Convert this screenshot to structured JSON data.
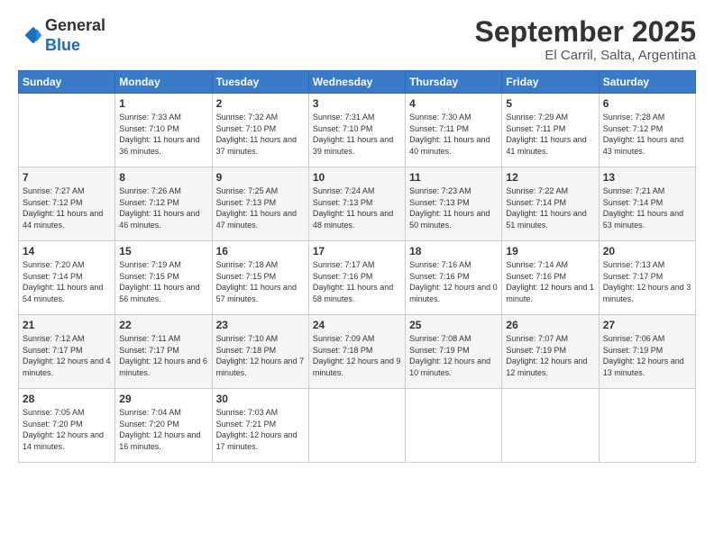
{
  "header": {
    "logo": {
      "line1": "General",
      "line2": "Blue"
    },
    "title": "September 2025",
    "subtitle": "El Carril, Salta, Argentina"
  },
  "weekdays": [
    "Sunday",
    "Monday",
    "Tuesday",
    "Wednesday",
    "Thursday",
    "Friday",
    "Saturday"
  ],
  "weeks": [
    [
      {
        "day": "",
        "sunrise": "",
        "sunset": "",
        "daylight": ""
      },
      {
        "day": "1",
        "sunrise": "Sunrise: 7:33 AM",
        "sunset": "Sunset: 7:10 PM",
        "daylight": "Daylight: 11 hours and 36 minutes."
      },
      {
        "day": "2",
        "sunrise": "Sunrise: 7:32 AM",
        "sunset": "Sunset: 7:10 PM",
        "daylight": "Daylight: 11 hours and 37 minutes."
      },
      {
        "day": "3",
        "sunrise": "Sunrise: 7:31 AM",
        "sunset": "Sunset: 7:10 PM",
        "daylight": "Daylight: 11 hours and 39 minutes."
      },
      {
        "day": "4",
        "sunrise": "Sunrise: 7:30 AM",
        "sunset": "Sunset: 7:11 PM",
        "daylight": "Daylight: 11 hours and 40 minutes."
      },
      {
        "day": "5",
        "sunrise": "Sunrise: 7:29 AM",
        "sunset": "Sunset: 7:11 PM",
        "daylight": "Daylight: 11 hours and 41 minutes."
      },
      {
        "day": "6",
        "sunrise": "Sunrise: 7:28 AM",
        "sunset": "Sunset: 7:12 PM",
        "daylight": "Daylight: 11 hours and 43 minutes."
      }
    ],
    [
      {
        "day": "7",
        "sunrise": "Sunrise: 7:27 AM",
        "sunset": "Sunset: 7:12 PM",
        "daylight": "Daylight: 11 hours and 44 minutes."
      },
      {
        "day": "8",
        "sunrise": "Sunrise: 7:26 AM",
        "sunset": "Sunset: 7:12 PM",
        "daylight": "Daylight: 11 hours and 46 minutes."
      },
      {
        "day": "9",
        "sunrise": "Sunrise: 7:25 AM",
        "sunset": "Sunset: 7:13 PM",
        "daylight": "Daylight: 11 hours and 47 minutes."
      },
      {
        "day": "10",
        "sunrise": "Sunrise: 7:24 AM",
        "sunset": "Sunset: 7:13 PM",
        "daylight": "Daylight: 11 hours and 48 minutes."
      },
      {
        "day": "11",
        "sunrise": "Sunrise: 7:23 AM",
        "sunset": "Sunset: 7:13 PM",
        "daylight": "Daylight: 11 hours and 50 minutes."
      },
      {
        "day": "12",
        "sunrise": "Sunrise: 7:22 AM",
        "sunset": "Sunset: 7:14 PM",
        "daylight": "Daylight: 11 hours and 51 minutes."
      },
      {
        "day": "13",
        "sunrise": "Sunrise: 7:21 AM",
        "sunset": "Sunset: 7:14 PM",
        "daylight": "Daylight: 11 hours and 53 minutes."
      }
    ],
    [
      {
        "day": "14",
        "sunrise": "Sunrise: 7:20 AM",
        "sunset": "Sunset: 7:14 PM",
        "daylight": "Daylight: 11 hours and 54 minutes."
      },
      {
        "day": "15",
        "sunrise": "Sunrise: 7:19 AM",
        "sunset": "Sunset: 7:15 PM",
        "daylight": "Daylight: 11 hours and 56 minutes."
      },
      {
        "day": "16",
        "sunrise": "Sunrise: 7:18 AM",
        "sunset": "Sunset: 7:15 PM",
        "daylight": "Daylight: 11 hours and 57 minutes."
      },
      {
        "day": "17",
        "sunrise": "Sunrise: 7:17 AM",
        "sunset": "Sunset: 7:16 PM",
        "daylight": "Daylight: 11 hours and 58 minutes."
      },
      {
        "day": "18",
        "sunrise": "Sunrise: 7:16 AM",
        "sunset": "Sunset: 7:16 PM",
        "daylight": "Daylight: 12 hours and 0 minutes."
      },
      {
        "day": "19",
        "sunrise": "Sunrise: 7:14 AM",
        "sunset": "Sunset: 7:16 PM",
        "daylight": "Daylight: 12 hours and 1 minute."
      },
      {
        "day": "20",
        "sunrise": "Sunrise: 7:13 AM",
        "sunset": "Sunset: 7:17 PM",
        "daylight": "Daylight: 12 hours and 3 minutes."
      }
    ],
    [
      {
        "day": "21",
        "sunrise": "Sunrise: 7:12 AM",
        "sunset": "Sunset: 7:17 PM",
        "daylight": "Daylight: 12 hours and 4 minutes."
      },
      {
        "day": "22",
        "sunrise": "Sunrise: 7:11 AM",
        "sunset": "Sunset: 7:17 PM",
        "daylight": "Daylight: 12 hours and 6 minutes."
      },
      {
        "day": "23",
        "sunrise": "Sunrise: 7:10 AM",
        "sunset": "Sunset: 7:18 PM",
        "daylight": "Daylight: 12 hours and 7 minutes."
      },
      {
        "day": "24",
        "sunrise": "Sunrise: 7:09 AM",
        "sunset": "Sunset: 7:18 PM",
        "daylight": "Daylight: 12 hours and 9 minutes."
      },
      {
        "day": "25",
        "sunrise": "Sunrise: 7:08 AM",
        "sunset": "Sunset: 7:19 PM",
        "daylight": "Daylight: 12 hours and 10 minutes."
      },
      {
        "day": "26",
        "sunrise": "Sunrise: 7:07 AM",
        "sunset": "Sunset: 7:19 PM",
        "daylight": "Daylight: 12 hours and 12 minutes."
      },
      {
        "day": "27",
        "sunrise": "Sunrise: 7:06 AM",
        "sunset": "Sunset: 7:19 PM",
        "daylight": "Daylight: 12 hours and 13 minutes."
      }
    ],
    [
      {
        "day": "28",
        "sunrise": "Sunrise: 7:05 AM",
        "sunset": "Sunset: 7:20 PM",
        "daylight": "Daylight: 12 hours and 14 minutes."
      },
      {
        "day": "29",
        "sunrise": "Sunrise: 7:04 AM",
        "sunset": "Sunset: 7:20 PM",
        "daylight": "Daylight: 12 hours and 16 minutes."
      },
      {
        "day": "30",
        "sunrise": "Sunrise: 7:03 AM",
        "sunset": "Sunset: 7:21 PM",
        "daylight": "Daylight: 12 hours and 17 minutes."
      },
      {
        "day": "",
        "sunrise": "",
        "sunset": "",
        "daylight": ""
      },
      {
        "day": "",
        "sunrise": "",
        "sunset": "",
        "daylight": ""
      },
      {
        "day": "",
        "sunrise": "",
        "sunset": "",
        "daylight": ""
      },
      {
        "day": "",
        "sunrise": "",
        "sunset": "",
        "daylight": ""
      }
    ]
  ]
}
